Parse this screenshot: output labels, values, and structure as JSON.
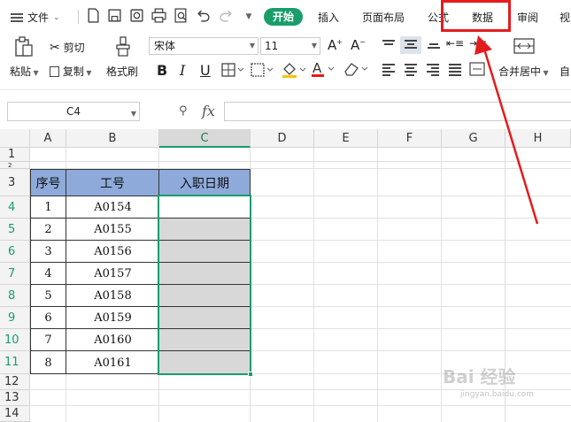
{
  "menubar": {
    "file_label": "文件",
    "tabs": [
      "开始",
      "插入",
      "页面布局",
      "公式",
      "数据",
      "审阅",
      "视"
    ],
    "active_tab": "开始",
    "highlighted_tab": "数据"
  },
  "ribbon": {
    "paste_label": "粘贴",
    "cut_label": "剪切",
    "copy_label": "复制",
    "format_painter_label": "格式刷",
    "font_name": "宋体",
    "font_size": "11",
    "merge_label": "合并居中",
    "auto_label": "自"
  },
  "formula_bar": {
    "cell_ref": "C4",
    "fx_label": "fx",
    "formula": ""
  },
  "sheet": {
    "columns": [
      "A",
      "B",
      "C",
      "D",
      "E",
      "F",
      "G",
      "H"
    ],
    "selected_column": "C",
    "rows": [
      "1",
      "2",
      "3",
      "4",
      "5",
      "6",
      "7",
      "8",
      "9",
      "10",
      "11",
      "12",
      "13",
      "14"
    ],
    "table_headers": [
      "序号",
      "工号",
      "入职日期"
    ],
    "table_rows": [
      {
        "no": "1",
        "id": "A0154",
        "date": ""
      },
      {
        "no": "2",
        "id": "A0155",
        "date": ""
      },
      {
        "no": "3",
        "id": "A0156",
        "date": ""
      },
      {
        "no": "4",
        "id": "A0157",
        "date": ""
      },
      {
        "no": "5",
        "id": "A0158",
        "date": ""
      },
      {
        "no": "6",
        "id": "A0159",
        "date": ""
      },
      {
        "no": "7",
        "id": "A0160",
        "date": ""
      },
      {
        "no": "8",
        "id": "A0161",
        "date": ""
      }
    ]
  },
  "colors": {
    "accent_green": "#1a9d6b",
    "header_blue": "#8eaadb",
    "highlight_red": "#e31c1c",
    "selected_gray": "#d8d8d8"
  },
  "watermark": {
    "main": "Bai 经验",
    "sub": "jingyan.baidu.com"
  }
}
